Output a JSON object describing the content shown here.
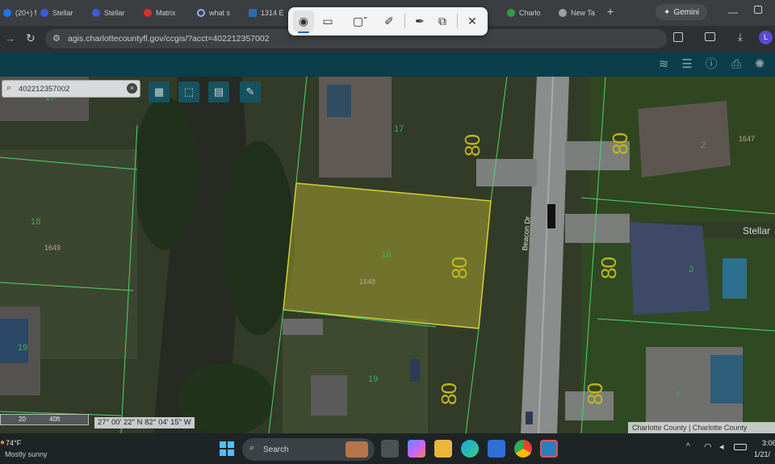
{
  "browser": {
    "tabs": [
      {
        "label": "(20+) f",
        "color": "#1877f2"
      },
      {
        "label": "Stellar",
        "color": "#3b5bdb"
      },
      {
        "label": "Stellar",
        "color": "#3b5bdb"
      },
      {
        "label": "Matrix",
        "color": "#d93025"
      },
      {
        "label": "what s",
        "color": "#8ab4f8"
      },
      {
        "label": "1314 E",
        "color": "#2b6cb0"
      },
      {
        "label": "Charlo",
        "color": "#2f9e44"
      },
      {
        "label": "New Ta",
        "color": "#9aa0a6"
      }
    ],
    "gemini_label": "Gemini",
    "url": "agis.charlottecountyfl.gov/ccgis/?acct=402212357002",
    "profile_initial": "L"
  },
  "map": {
    "search_value": "402212357002",
    "coordinates": "27° 00' 22\" N 82° 04' 15\" W",
    "attribution": "Charlotte County | Charlotte County",
    "street": "Beacon Dr",
    "scale_value": "20",
    "scale_unit": "40ft",
    "place_label": "Stellar",
    "lots": [
      {
        "lot": "17",
        "addr": ""
      },
      {
        "lot": "17",
        "addr": ""
      },
      {
        "lot": "18",
        "addr": "1649"
      },
      {
        "lot": "18",
        "addr": "1648"
      },
      {
        "lot": "19",
        "addr": ""
      },
      {
        "lot": "19",
        "addr": ""
      },
      {
        "lot": "2",
        "addr": "1647"
      },
      {
        "lot": "3",
        "addr": ""
      },
      {
        "lot": "4",
        "addr": ""
      }
    ],
    "zoning_code": "80"
  },
  "taskbar": {
    "temperature": "74°F",
    "weather": "Mostly sunny",
    "search_placeholder": "Search",
    "time": "3:06",
    "date": "1/21/"
  },
  "colors": {
    "app_header": "#0b3d4a",
    "selected_parcel": "#d7cf36",
    "parcel_lines": "#4fd46a",
    "zoning_text": "#c2b81c"
  }
}
